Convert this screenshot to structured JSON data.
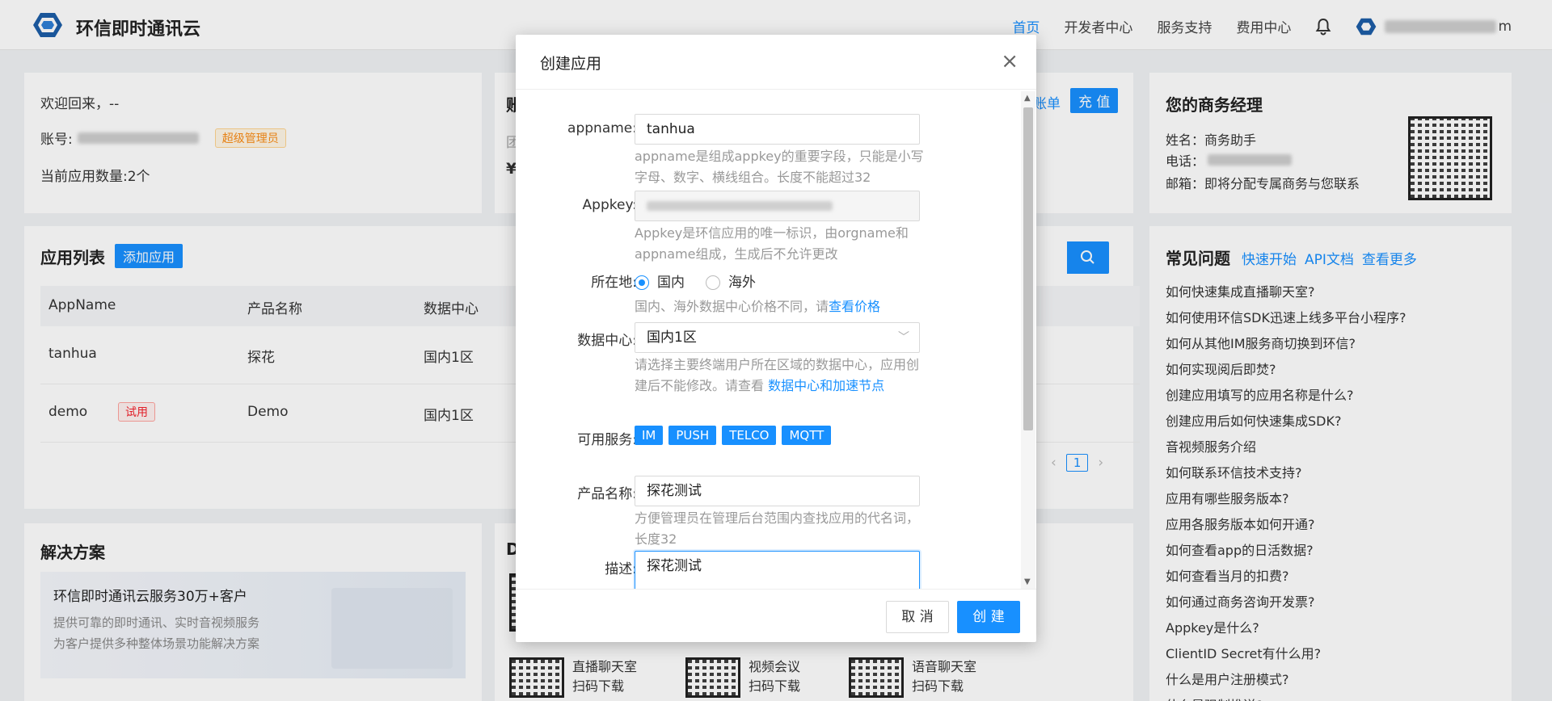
{
  "header": {
    "brand": "环信即时通讯云",
    "nav": [
      "首页",
      "开发者中心",
      "服务支持",
      "费用中心"
    ],
    "user_suffix": "m"
  },
  "welcome": {
    "greeting": "欢迎回来，--",
    "account_label": "账号:",
    "role_badge": "超级管理员",
    "app_count": "当前应用数量:2个"
  },
  "account_panel": {
    "title_fragment": "账",
    "line2": "团",
    "line3": "¥",
    "bill_link": "账单",
    "recharge_button": "充 值"
  },
  "app_list": {
    "title": "应用列表",
    "add_button": "添加应用",
    "columns": [
      "AppName",
      "产品名称",
      "数据中心"
    ],
    "rows": [
      {
        "name": "tanhua",
        "product": "探花",
        "dc": "国内1区",
        "badge": ""
      },
      {
        "name": "demo",
        "product": "Demo",
        "dc": "国内1区",
        "badge": "试用"
      }
    ],
    "page": "1"
  },
  "solutions": {
    "title": "解决方案",
    "banner_title": "环信即时通讯云服务30万+客户",
    "banner_text1": "提供可靠的即时通讯、实时音视频服务",
    "banner_text2": "为客户提供多种整体场景功能解决方案"
  },
  "downloads": {
    "title": "D",
    "items": [
      {
        "name": "直播聊天室",
        "action": "扫码下载"
      },
      {
        "name": "视频会议",
        "action": "扫码下载"
      },
      {
        "name": "语音聊天室",
        "action": "扫码下载"
      }
    ]
  },
  "manager": {
    "title": "您的商务经理",
    "name": "姓名：商务助手",
    "phone": "电话：",
    "email": "邮箱：即将分配专属商务与您联系"
  },
  "faq": {
    "title": "常见问题",
    "links": [
      "快速开始",
      "API文档",
      "查看更多"
    ],
    "items": [
      "如何快速集成直播聊天室?",
      "如何使用环信SDK迅速上线多平台小程序?",
      "如何从其他IM服务商切换到环信?",
      "如何实现阅后即焚?",
      "创建应用填写的应用名称是什么?",
      "创建应用后如何快速集成SDK?",
      "音视频服务介绍",
      "如何联系环信技术支持?",
      "应用有哪些服务版本?",
      "应用各服务版本如何开通?",
      "如何查看app的日活数据?",
      "如何查看当月的扣费?",
      "如何通过商务咨询开发票?",
      "Appkey是什么?",
      "ClientID Secret有什么用?",
      "什么是用户注册模式?",
      "什么是强制推送?"
    ]
  },
  "modal": {
    "title": "创建应用",
    "appname_label": "appname:",
    "appname_value": "tanhua",
    "appname_help": "appname是组成appkey的重要字段，只能是小写字母、数字、横线组合。长度不能超过32",
    "appkey_label": "Appkey:",
    "appkey_help": "Appkey是环信应用的唯一标识，由orgname和appname组成，生成后不允许更改",
    "location_label": "所在地:",
    "location_domestic": "国内",
    "location_overseas": "海外",
    "location_help": "国内、海外数据中心价格不同，请",
    "location_help_link": "查看价格",
    "dc_label": "数据中心:",
    "dc_value": "国内1区",
    "dc_help": "请选择主要终端用户所在区域的数据中心，应用创建后不能修改。请查看 ",
    "dc_help_link": "数据中心和加速节点",
    "services_label": "可用服务:",
    "services": [
      "IM",
      "PUSH",
      "TELCO",
      "MQTT"
    ],
    "product_label": "产品名称:",
    "product_value": "探花测试",
    "product_help": "方便管理员在管理后台范围内查找应用的代名词，长度32",
    "desc_label": "描述:",
    "desc_value": "探花测试",
    "cancel_button": "取 消",
    "create_button": "创 建"
  },
  "colors": {
    "accent": "#1890ff",
    "badge_admin": "#fa8c16",
    "badge_trial": "#f5222d"
  }
}
